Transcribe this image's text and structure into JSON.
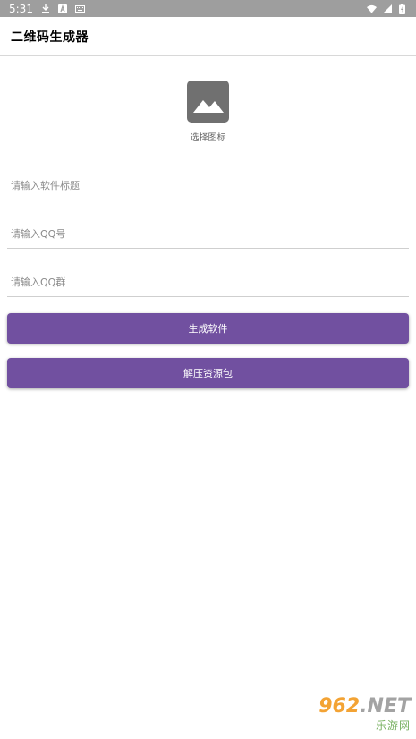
{
  "status_bar": {
    "time": "5:31",
    "left_icons": [
      "download-icon",
      "a-box-icon",
      "keyboard-icon"
    ],
    "right_icons": [
      "wifi-icon",
      "signal-icon",
      "battery-icon"
    ]
  },
  "app_bar": {
    "title": "二维码生成器"
  },
  "icon_picker": {
    "label": "选择图标",
    "icon": "image-icon"
  },
  "form": {
    "title_placeholder": "请输入软件标题",
    "qq_placeholder": "请输入QQ号",
    "qq_group_placeholder": "请输入QQ群"
  },
  "buttons": {
    "generate_label": "生成软件",
    "extract_label": "解压资源包"
  },
  "watermark": {
    "top_num": "962",
    "top_net": ".NET",
    "bottom": "乐游网"
  },
  "colors": {
    "accent": "#7150a0",
    "status_bar": "#9e9e9e"
  }
}
